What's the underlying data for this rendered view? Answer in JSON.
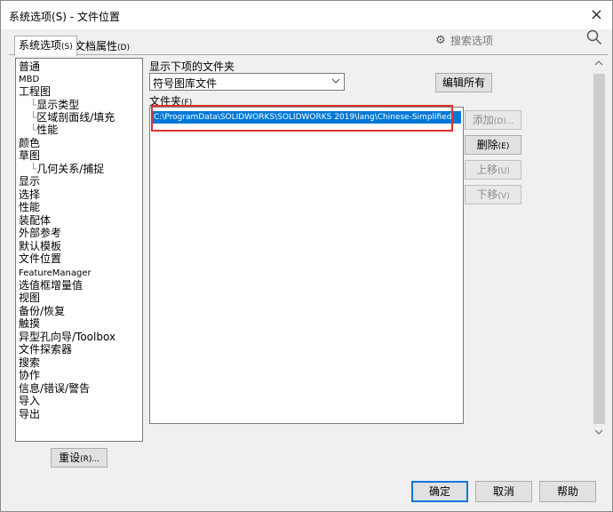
{
  "window": {
    "title": "系统选项(S) - 文件位置",
    "close_glyph": "×"
  },
  "tabs": [
    {
      "label": "系统选项",
      "shortcut": "(S)"
    },
    {
      "label": "文档属性",
      "shortcut": "(D)"
    }
  ],
  "search": {
    "placeholder": "搜索选项",
    "icon": "gear-search-icon"
  },
  "sidebar": {
    "items": [
      {
        "label": "普通"
      },
      {
        "label": "MBD"
      },
      {
        "label": "工程图"
      },
      {
        "label": "显示类型"
      },
      {
        "label": "区域剖面线/填充"
      },
      {
        "label": "性能"
      },
      {
        "label": "颜色"
      },
      {
        "label": "草图"
      },
      {
        "label": "几何关系/捕捉"
      },
      {
        "label": "显示"
      },
      {
        "label": "选择"
      },
      {
        "label": "性能"
      },
      {
        "label": "装配体"
      },
      {
        "label": "外部参考"
      },
      {
        "label": "默认模板"
      },
      {
        "label": "文件位置"
      },
      {
        "label": "FeatureManager"
      },
      {
        "label": "选值框增量值"
      },
      {
        "label": "视图"
      },
      {
        "label": "备份/恢复"
      },
      {
        "label": "触摸"
      },
      {
        "label": "异型孔向导/Toolbox"
      },
      {
        "label": "文件探索器"
      },
      {
        "label": "搜索"
      },
      {
        "label": "协作"
      },
      {
        "label": "信息/错误/警告"
      },
      {
        "label": "导入"
      },
      {
        "label": "导出"
      }
    ]
  },
  "main": {
    "show_folders_label": "显示下项的文件夹",
    "folder_type_selected": "符号图库文件",
    "edit_all_label": "编辑所有",
    "folders_label": "文件夹",
    "folders_shortcut": "(F)",
    "folders": [
      "C:\\ProgramData\\SOLIDWORKS\\SOLIDWORKS 2019\\lang\\Chinese-Simplified"
    ],
    "add_label": "添加",
    "add_shortcut": "(D)...",
    "delete_label": "删除",
    "delete_shortcut": "(E)",
    "up_label": "上移",
    "up_shortcut": "(U)",
    "down_label": "下移",
    "down_shortcut": "(V)"
  },
  "footer": {
    "reset_label": "重设",
    "reset_shortcut": "(R)...",
    "ok_label": "确定",
    "cancel_label": "取消",
    "help_label": "帮助"
  },
  "colors": {
    "selection": "#0078d7",
    "highlight_border": "#e03030"
  }
}
